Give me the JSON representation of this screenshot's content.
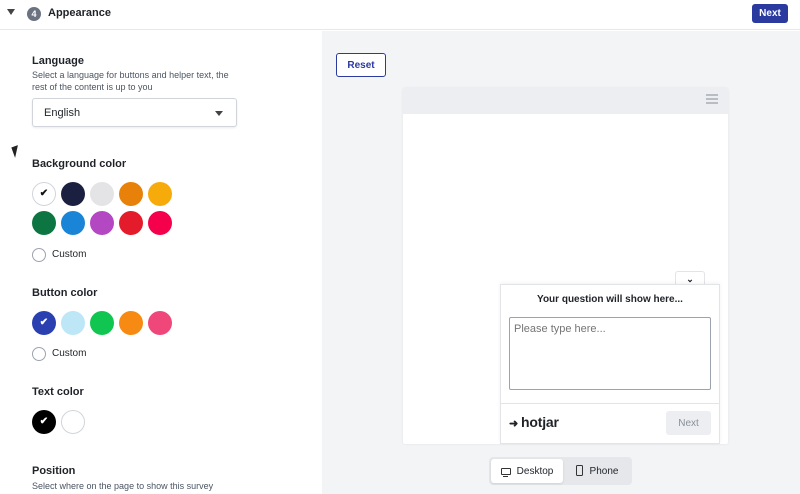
{
  "header": {
    "step_number": "4",
    "step_title": "Appearance",
    "next_label": "Next"
  },
  "language": {
    "title": "Language",
    "description": "Select a language for buttons and helper text, the rest of the content is up to you",
    "selected": "English"
  },
  "background_color": {
    "title": "Background color",
    "custom_label": "Custom",
    "swatches": [
      "#ffffff",
      "#1b2040",
      "#e4e4e6",
      "#e8810a",
      "#f7ab0a",
      "#0c7542",
      "#1a84d6",
      "#b348c2",
      "#e31b2a",
      "#f5004a"
    ],
    "selected_index": 0
  },
  "button_color": {
    "title": "Button color",
    "custom_label": "Custom",
    "swatches": [
      "#2a3fb0",
      "#bde6f6",
      "#10c651",
      "#f78a12",
      "#f0477a"
    ],
    "selected_index": 0
  },
  "text_color": {
    "title": "Text color",
    "swatches": [
      "#000000",
      "#ffffff"
    ],
    "selected_index": 0
  },
  "position": {
    "title": "Position",
    "description": "Select where on the page to show this survey"
  },
  "preview": {
    "reset_label": "Reset",
    "question": "Your question will show here...",
    "answer_placeholder": "Please type here...",
    "brand": "hotjar",
    "next_label": "Next",
    "collapse_icon": "chevron-down-icon",
    "menu_icon": "hamburger-menu-icon"
  },
  "device_toggle": {
    "desktop_label": "Desktop",
    "phone_label": "Phone",
    "selected": "Desktop"
  },
  "colors": {
    "accent": "#2a3a9f"
  }
}
